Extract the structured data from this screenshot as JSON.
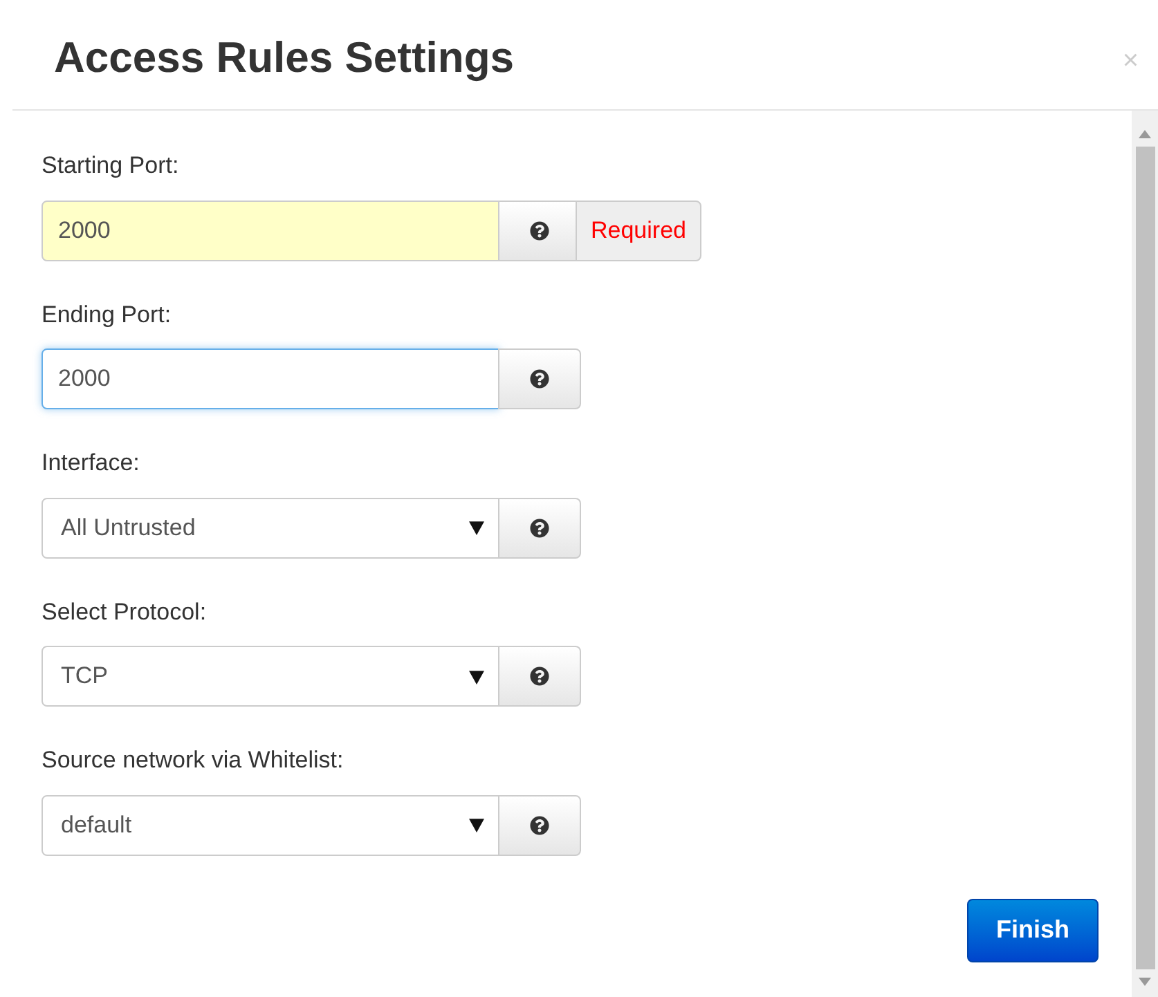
{
  "dialog": {
    "title": "Access Rules Settings",
    "close": "×"
  },
  "fields": [
    {
      "kind": "text",
      "label": "Starting Port:",
      "value": "2000",
      "invalid": true,
      "focused": false,
      "addon": "Required"
    },
    {
      "kind": "text",
      "label": "Ending Port:",
      "value": "2000",
      "invalid": false,
      "focused": true
    },
    {
      "kind": "select",
      "label": "Interface:",
      "value": "All Untrusted"
    },
    {
      "kind": "select",
      "label": "Select Protocol:",
      "value": "TCP"
    },
    {
      "kind": "select",
      "label": "Source network via Whitelist:",
      "value": "default"
    }
  ],
  "buttons": [
    {
      "label": "Finish"
    }
  ]
}
